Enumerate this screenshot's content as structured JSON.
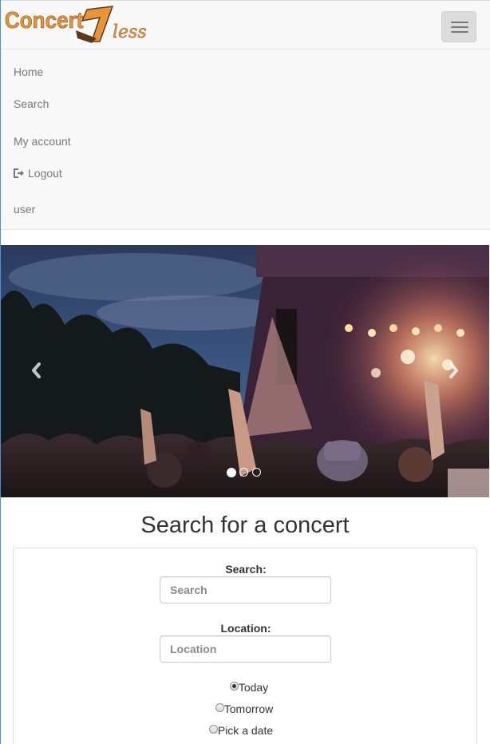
{
  "brand": {
    "word": "Concert",
    "number": "1",
    "suffix": "less",
    "colors": {
      "primary": "#e8943a",
      "dark": "#5a3a1a"
    }
  },
  "nav": {
    "toggle_icon": "hamburger-icon",
    "items": [
      {
        "label": "Home"
      },
      {
        "label": "Search"
      },
      {
        "label": "My account"
      },
      {
        "label": "Logout",
        "icon": "logout-icon"
      },
      {
        "label": "user"
      }
    ]
  },
  "carousel": {
    "prev_icon": "chevron-left-icon",
    "next_icon": "chevron-right-icon",
    "slide_count": 3,
    "active_slide": 1
  },
  "search_section": {
    "title": "Search for a concert",
    "search_label": "Search:",
    "search_placeholder": "Search",
    "location_label": "Location:",
    "location_placeholder": "Location",
    "date_options": [
      {
        "label": "Today",
        "checked": true
      },
      {
        "label": "Tomorrow",
        "checked": false
      },
      {
        "label": "Pick a date",
        "checked": false
      }
    ]
  }
}
